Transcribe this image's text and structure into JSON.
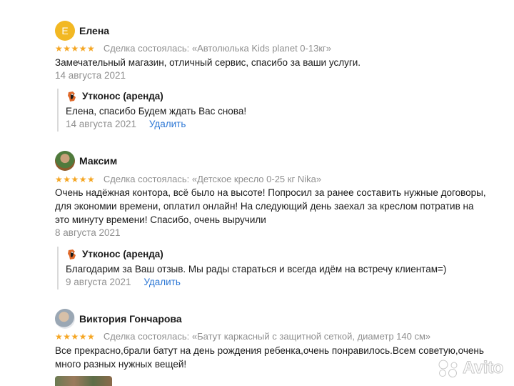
{
  "reviews": [
    {
      "avatar_letter": "Е",
      "author": "Елена",
      "stars": "★★★★★",
      "deal_label": "Сделка состоялась:",
      "deal_item": "«Автолюлька Kids planet 0-13кг»",
      "text": "Замечательный магазин, отличный сервис, спасибо за ваши услуги.",
      "date": "14 августа 2021",
      "reply": {
        "author": "Утконос (аренда)",
        "text": "Елена, спасибо Будем ждать Вас снова!",
        "date": "14 августа 2021",
        "delete_label": "Удалить"
      }
    },
    {
      "author": "Максим",
      "stars": "★★★★★",
      "deal_label": "Сделка состоялась:",
      "deal_item": "«Детское кресло 0-25 кг Nika»",
      "text_lines": [
        "Очень надёжная контора, всё было на высоте! Попросил за ранее составить нужные договоры,",
        "для экономии времени, оплатил онлайн! На следующий день заехал за креслом потратив на",
        "это минуту времени! Спасибо, очень выручили"
      ],
      "date": "8 августа 2021",
      "reply": {
        "author": "Утконос (аренда)",
        "text": "Благодарим за Ваш отзыв. Мы рады стараться и всегда идём на встречу клиентам=)",
        "date": "9 августа 2021",
        "delete_label": "Удалить"
      }
    },
    {
      "author": "Виктория Гончарова",
      "stars": "★★★★★",
      "deal_label": "Сделка состоялась:",
      "deal_item": "«Батут каркасный с защитной сеткой, диаметр 140 см»",
      "text_lines": [
        "Все прекрасно,брали батут на день рождения ребенка,очень понравилось.Всем советую,очень",
        "много разных нужных вещей!"
      ]
    }
  ],
  "watermark": "Avito",
  "colors": {
    "star": "#f5a623",
    "link": "#2b76d4",
    "muted": "#8f8f8f",
    "avatar_bg": "#f2b823"
  }
}
